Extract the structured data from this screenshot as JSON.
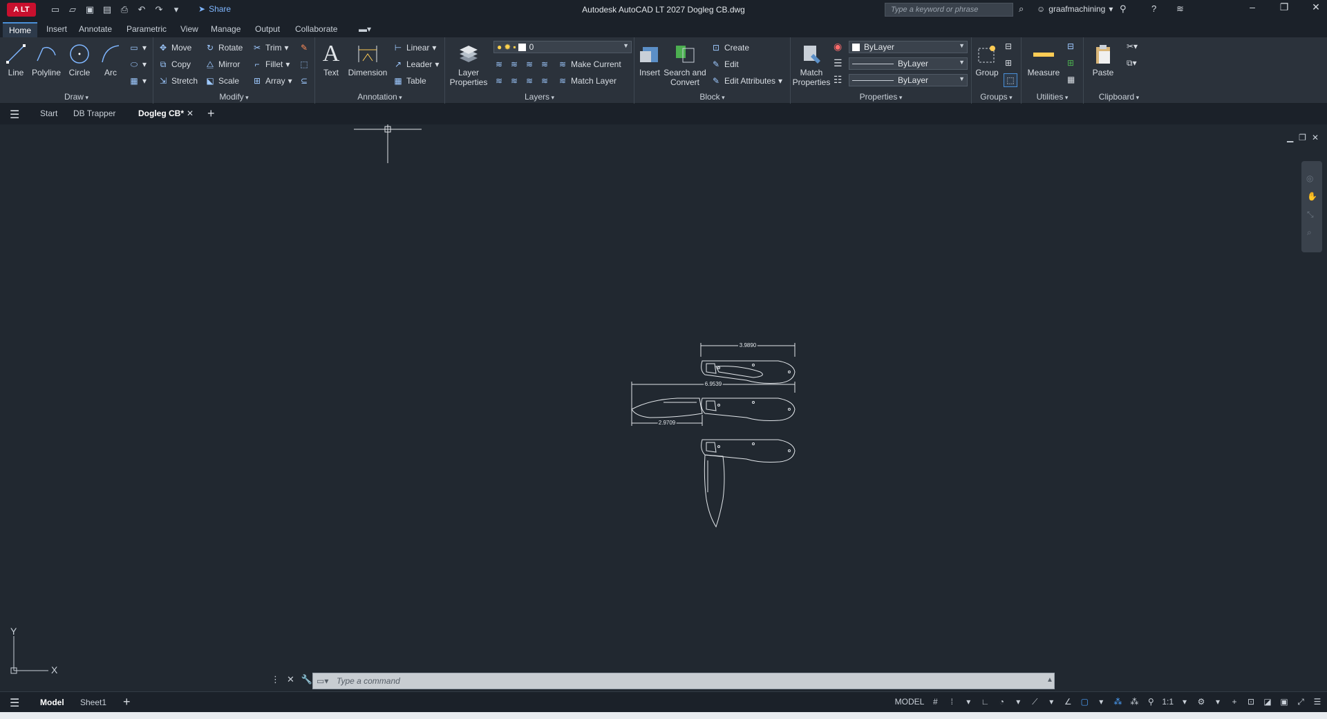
{
  "titlebar": {
    "app_badge": "A LT",
    "share_label": "Share",
    "title": "Autodesk AutoCAD LT 2027   Dogleg CB.dwg",
    "search_placeholder": "Type a keyword or phrase",
    "user_name": "graafmachining"
  },
  "menu": {
    "tabs": [
      "Home",
      "Insert",
      "Annotate",
      "Parametric",
      "View",
      "Manage",
      "Output",
      "Collaborate"
    ],
    "active": "Home"
  },
  "ribbon": {
    "draw": {
      "title": "Draw",
      "line": "Line",
      "polyline": "Polyline",
      "circle": "Circle",
      "arc": "Arc"
    },
    "modify": {
      "title": "Modify",
      "move": "Move",
      "rotate": "Rotate",
      "trim": "Trim",
      "copy": "Copy",
      "mirror": "Mirror",
      "fillet": "Fillet",
      "stretch": "Stretch",
      "scale": "Scale",
      "array": "Array"
    },
    "annotation": {
      "title": "Annotation",
      "text": "Text",
      "dimension": "Dimension",
      "linear": "Linear",
      "leader": "Leader",
      "table": "Table"
    },
    "layers": {
      "title": "Layers",
      "layer_properties": "Layer Properties",
      "current_layer": "0",
      "make_current": "Make Current",
      "match_layer": "Match Layer"
    },
    "block": {
      "title": "Block",
      "insert": "Insert",
      "search_convert": "Search and Convert",
      "create": "Create",
      "edit": "Edit",
      "edit_attributes": "Edit Attributes"
    },
    "properties": {
      "title": "Properties",
      "match_properties": "Match Properties",
      "color": "ByLayer",
      "lineweight": "ByLayer",
      "linetype": "ByLayer"
    },
    "groups": {
      "title": "Groups",
      "group": "Group"
    },
    "utilities": {
      "title": "Utilities",
      "measure": "Measure"
    },
    "clipboard": {
      "title": "Clipboard",
      "paste": "Paste"
    }
  },
  "doctabs": {
    "tabs": [
      "Start",
      "DB Trapper",
      "Dogleg CB*"
    ],
    "active": "Dogleg CB*"
  },
  "drawing": {
    "dim_top": "3.9890",
    "dim_overall": "6.9539",
    "dim_blade": "2.9709",
    "ucs_x": "X",
    "ucs_y": "Y"
  },
  "command": {
    "placeholder": "Type a command"
  },
  "status": {
    "layout_tabs": [
      "Model",
      "Sheet1"
    ],
    "active": "Model",
    "mode": "MODEL",
    "scale": "1:1"
  },
  "colors": {
    "accent": "#4a90d9",
    "canvas": "#212830",
    "ribbon": "#2b323b",
    "brand": "#c8102e"
  }
}
